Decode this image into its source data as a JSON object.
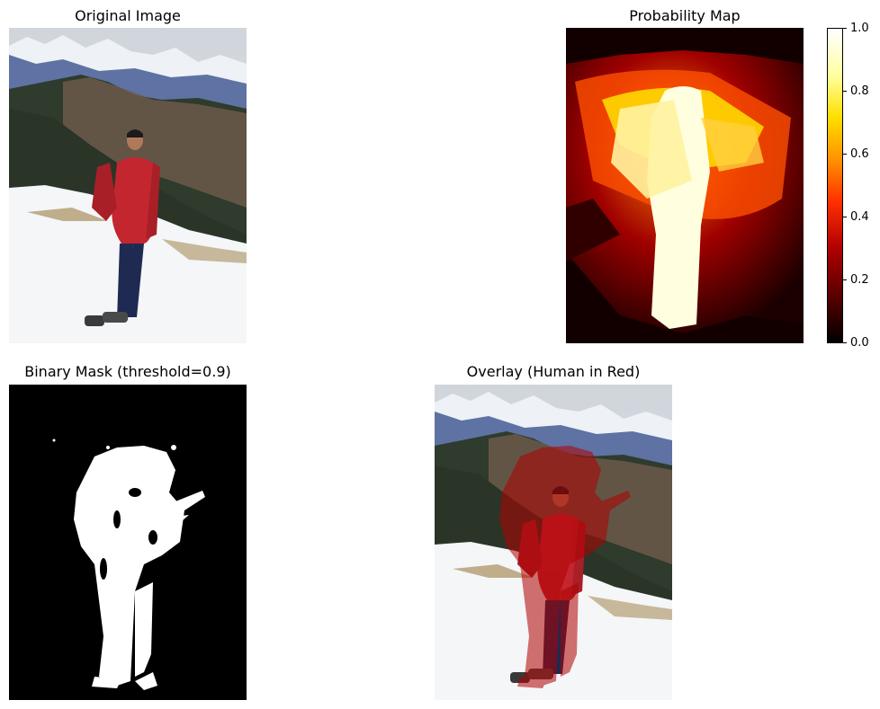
{
  "panels": {
    "original": {
      "title": "Original Image"
    },
    "probability": {
      "title": "Probability Map"
    },
    "mask": {
      "title": "Binary Mask (threshold=0.9)"
    },
    "overlay": {
      "title": "Overlay (Human in Red)"
    }
  },
  "colorbar": {
    "ticks": [
      "1.0",
      "0.8",
      "0.6",
      "0.4",
      "0.2",
      "0.0"
    ],
    "colormap": [
      "#000000",
      "#5a0000",
      "#b00000",
      "#ff3000",
      "#ff9000",
      "#ffe000",
      "#ffffcc",
      "#ffffff"
    ]
  },
  "colors": {
    "overlay_tint": "#b00000",
    "jacket": "#c4262f",
    "jeans": "#1f2a52",
    "snow": "#f4f6f8",
    "sky": "#d8dde2",
    "mountain": "#5e72a3",
    "forest": "#2d3a2a",
    "hill": "#6b5a4a"
  }
}
